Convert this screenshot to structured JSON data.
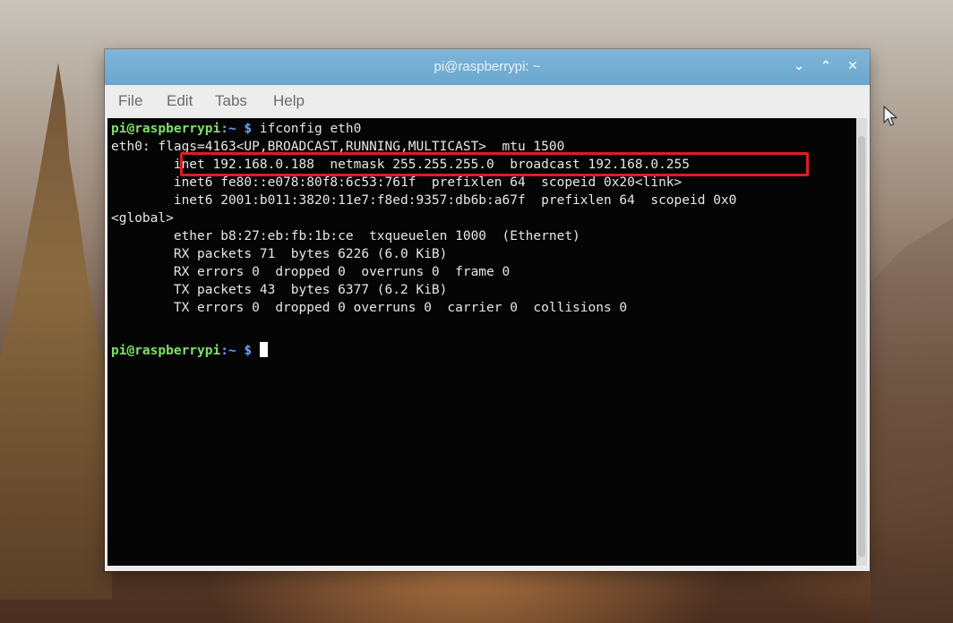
{
  "window": {
    "title": "pi@raspberrypi: ~",
    "controls": {
      "minimize": "⌄",
      "maximize": "⌃",
      "close": "✕"
    }
  },
  "menu": [
    "File",
    "Edit",
    "Tabs",
    "Help"
  ],
  "terminal": {
    "prompt_user": "pi@raspberrypi",
    "prompt_path": ":~ $",
    "command": "ifconfig eth0",
    "lines": [
      "eth0: flags=4163<UP,BROADCAST,RUNNING,MULTICAST>  mtu 1500",
      "        inet 192.168.0.188  netmask 255.255.255.0  broadcast 192.168.0.255",
      "        inet6 fe80::e078:80f8:6c53:761f  prefixlen 64  scopeid 0x20<link>",
      "        inet6 2001:b011:3820:11e7:f8ed:9357:db6b:a67f  prefixlen 64  scopeid 0x0",
      "<global>",
      "        ether b8:27:eb:fb:1b:ce  txqueuelen 1000  (Ethernet)",
      "        RX packets 71  bytes 6226 (6.0 KiB)",
      "        RX errors 0  dropped 0  overruns 0  frame 0",
      "        TX packets 43  bytes 6377 (6.2 KiB)",
      "        TX errors 0  dropped 0 overruns 0  carrier 0  collisions 0",
      ""
    ],
    "highlight_color": "#e01b24"
  },
  "icons": {
    "mouse_cursor": "mouse-pointer-icon"
  },
  "colors": {
    "titlebar": "#6aa7cf",
    "prompt_user": "#7ee06b",
    "prompt_path": "#6aa0ff",
    "terminal_bg": "#050505"
  }
}
